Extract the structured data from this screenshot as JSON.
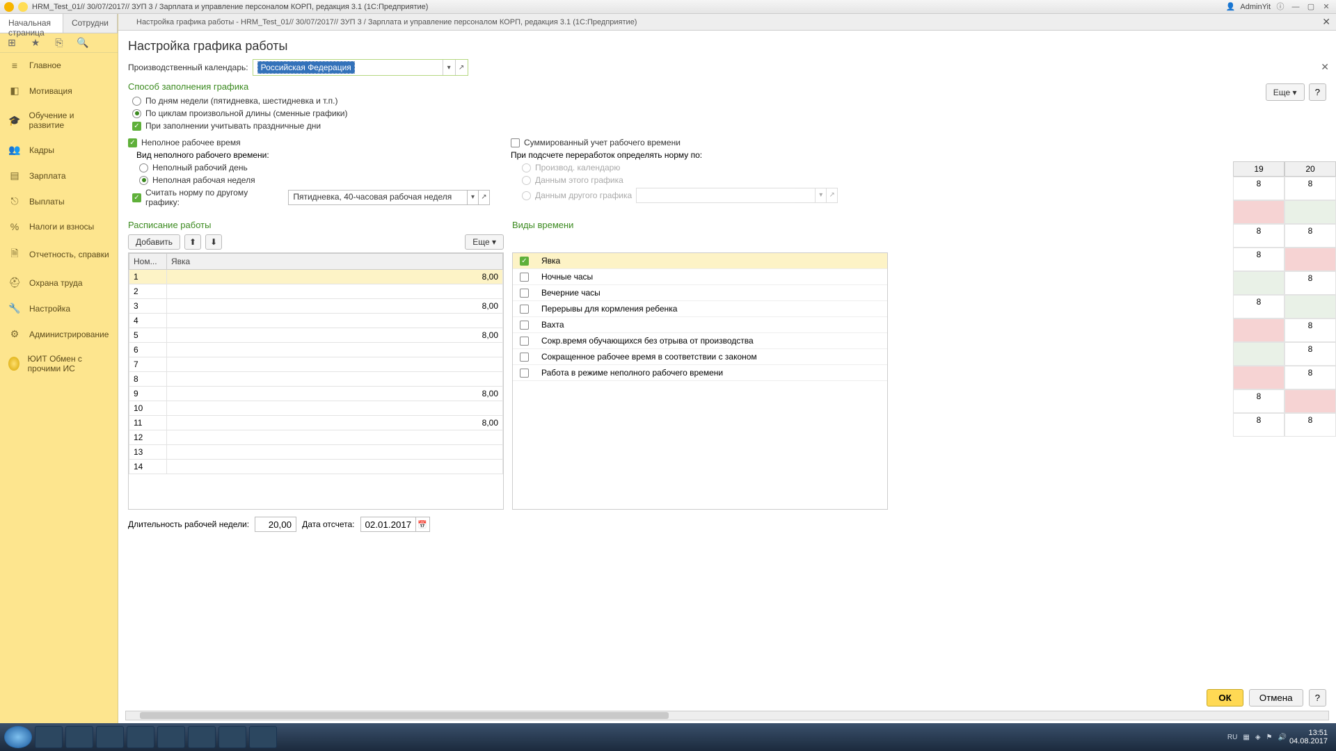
{
  "app": {
    "title": "HRM_Test_01// 30/07/2017// ЗУП 3 / Зарплата и управление персоналом КОРП, редакция 3.1  (1С:Предприятие)",
    "user": "AdminYit"
  },
  "tabs_top": {
    "home": "Начальная страница",
    "second": "Сотрудни"
  },
  "nav": {
    "main": "Главное",
    "motiv": "Мотивация",
    "edu": "Обучение и развитие",
    "kadry": "Кадры",
    "zarplata": "Зарплата",
    "vyplaty": "Выплаты",
    "nalogi": "Налоги и взносы",
    "otchet": "Отчетность, справки",
    "ohrana": "Охрана труда",
    "nastr": "Настройка",
    "admin": "Администрирование",
    "yuit": "ЮИТ Обмен с прочими ИС"
  },
  "dialog": {
    "bar": "Настройка графика работы - HRM_Test_01// 30/07/2017// ЗУП 3 / Зарплата и управление персоналом КОРП, редакция 3.1  (1С:Предприятие)",
    "title": "Настройка графика работы"
  },
  "form": {
    "calendar_label": "Производственный календарь:",
    "calendar_value": "Российская Федерация",
    "section_fill": "Способ заполнения графика",
    "radio_days": "По дням недели (пятидневка, шестидневка и т.п.)",
    "radio_cycles": "По циклам произвольной длины (сменные графики)",
    "chk_holidays": "При заполнении учитывать праздничные дни",
    "chk_parttime": "Неполное рабочее время",
    "chk_summ": "Суммированный учет рабочего времени",
    "label_kind": "Вид неполного рабочего времени:",
    "radio_partday": "Неполный рабочий день",
    "radio_partweek": "Неполная рабочая неделя",
    "chk_othernorm": "Считать норму по другому графику:",
    "norm_value": "Пятидневка, 40-часовая рабочая неделя",
    "label_pererab": "При подсчете переработок определять норму по:",
    "radio_prod": "Производ. календарю",
    "radio_thisgraph": "Данным этого графика",
    "radio_othergraph": "Данным другого графика"
  },
  "schedule": {
    "title": "Расписание работы",
    "btn_add": "Добавить",
    "btn_more": "Еще",
    "col_num": "Ном...",
    "col_yavka": "Явка",
    "rows": [
      {
        "n": "1",
        "v": "8,00"
      },
      {
        "n": "2",
        "v": ""
      },
      {
        "n": "3",
        "v": "8,00"
      },
      {
        "n": "4",
        "v": ""
      },
      {
        "n": "5",
        "v": "8,00"
      },
      {
        "n": "6",
        "v": ""
      },
      {
        "n": "7",
        "v": ""
      },
      {
        "n": "8",
        "v": ""
      },
      {
        "n": "9",
        "v": "8,00"
      },
      {
        "n": "10",
        "v": ""
      },
      {
        "n": "11",
        "v": "8,00"
      },
      {
        "n": "12",
        "v": ""
      },
      {
        "n": "13",
        "v": ""
      },
      {
        "n": "14",
        "v": ""
      }
    ]
  },
  "types": {
    "title": "Виды времени",
    "rows": [
      {
        "c": true,
        "t": "Явка"
      },
      {
        "c": false,
        "t": "Ночные часы"
      },
      {
        "c": false,
        "t": "Вечерние часы"
      },
      {
        "c": false,
        "t": "Перерывы для кормления ребенка"
      },
      {
        "c": false,
        "t": "Вахта"
      },
      {
        "c": false,
        "t": "Сокр.время обучающихся без отрыва от производства"
      },
      {
        "c": false,
        "t": "Сокращенное рабочее время в соответствии с законом"
      },
      {
        "c": false,
        "t": "Работа в режиме неполного рабочего времени"
      }
    ]
  },
  "bottom": {
    "dur_label": "Длительность рабочей недели:",
    "dur_value": "20,00",
    "date_label": "Дата отсчета:",
    "date_value": "02.01.2017"
  },
  "buttons": {
    "ok": "ОК",
    "cancel": "Отмена",
    "q": "?",
    "more": "Еще"
  },
  "right_cols": {
    "c19": "19",
    "c20": "20"
  },
  "right_rows": [
    {
      "a": "8",
      "ca": "",
      "b": "8",
      "cb": ""
    },
    {
      "a": "",
      "ca": "pink",
      "b": "",
      "cb": "pale"
    },
    {
      "a": "8",
      "ca": "",
      "b": "8",
      "cb": ""
    },
    {
      "a": "8",
      "ca": "",
      "b": "",
      "cb": "pink"
    },
    {
      "a": "",
      "ca": "pale",
      "b": "8",
      "cb": ""
    },
    {
      "a": "8",
      "ca": "",
      "b": "",
      "cb": "pale"
    },
    {
      "a": "",
      "ca": "pink",
      "b": "8",
      "cb": ""
    },
    {
      "a": "",
      "ca": "pale",
      "b": "8",
      "cb": ""
    },
    {
      "a": "",
      "ca": "pink",
      "b": "8",
      "cb": ""
    },
    {
      "a": "8",
      "ca": "",
      "b": "",
      "cb": "pink"
    },
    {
      "a": "8",
      "ca": "",
      "b": "8",
      "cb": ""
    }
  ],
  "tray": {
    "lang": "RU",
    "time": "13:51",
    "date": "04.08.2017"
  }
}
